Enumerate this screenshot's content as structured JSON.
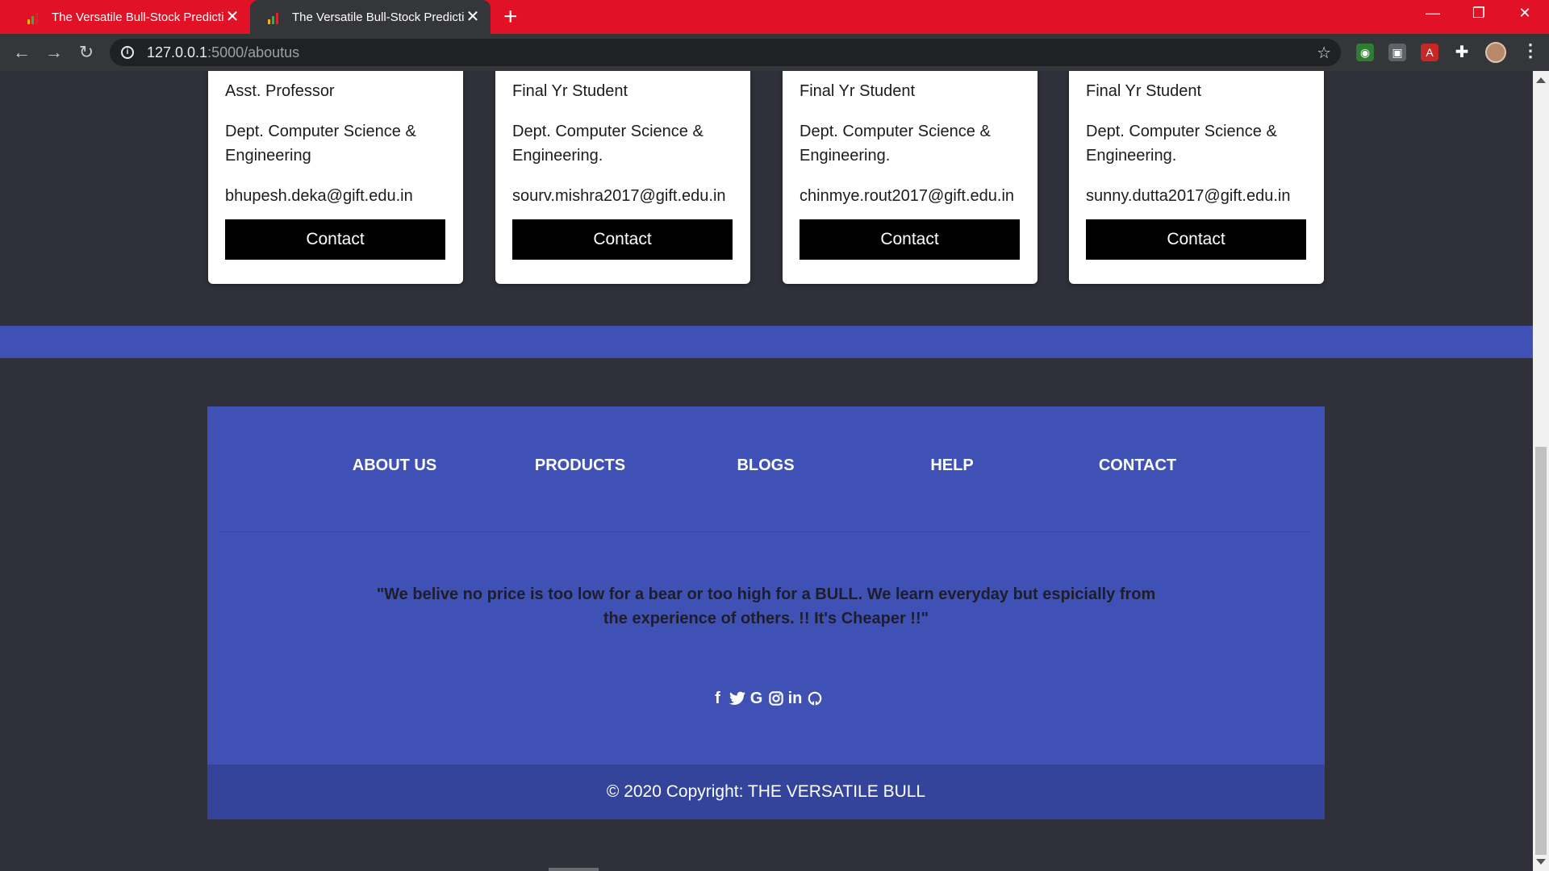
{
  "browser": {
    "tabs": [
      {
        "title": "The Versatile Bull-Stock Prediction",
        "active": false
      },
      {
        "title": "The Versatile Bull-Stock Prediction",
        "active": true
      }
    ],
    "new_tab_icon": "plus-icon",
    "address": {
      "host": "127.0.0.1",
      "path": ":5000/aboutus"
    },
    "accent_color": "#e11226"
  },
  "team": [
    {
      "role": "Asst. Professor",
      "dept": "Dept. Computer Science & Engineering",
      "email": "bhupesh.deka@gift.edu.in",
      "button": "Contact"
    },
    {
      "role": "Final Yr Student",
      "dept": "Dept. Computer Science & Engineering.",
      "email": "sourv.mishra2017@gift.edu.in",
      "button": "Contact"
    },
    {
      "role": "Final Yr Student",
      "dept": "Dept. Computer Science & Engineering.",
      "email": "chinmye.rout2017@gift.edu.in",
      "button": "Contact"
    },
    {
      "role": "Final Yr Student",
      "dept": "Dept. Computer Science & Engineering.",
      "email": "sunny.dutta2017@gift.edu.in",
      "button": "Contact"
    }
  ],
  "footer": {
    "links": [
      "ABOUT US",
      "PRODUCTS",
      "BLOGS",
      "HELP",
      "CONTACT"
    ],
    "quote": "\"We belive no price is too low for a bear or too high for a BULL. We learn everyday but espicially from the experience of others. !! It's Cheaper !!\"",
    "social_icons": [
      "facebook-icon",
      "twitter-icon",
      "google-icon",
      "instagram-icon",
      "linkedin-icon",
      "github-icon"
    ],
    "copyright": "© 2020 Copyright: THE VERSATILE BULL",
    "background_color": "#3f51b5"
  }
}
